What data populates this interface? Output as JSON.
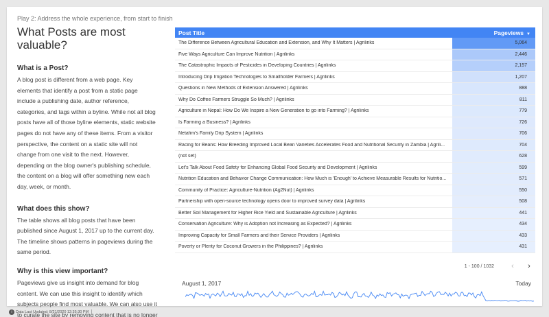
{
  "header": {
    "play_title": "Play 2: Address the whole experience, from start to finish",
    "main_title": "What Posts are most valuable?"
  },
  "sections": [
    {
      "heading": "What is a Post?",
      "body": "A blog post is different from a web page. Key elements that identify a post from a static page include a publishing date, author reference, categories, and tags within a byline. While not all blog posts have all of those byline elements, static website pages do not have any of these items. From a visitor perspective, the content on a static site will not change from one visit to the next. However, depending on the blog owner's publishing schedule, the content on a blog will offer something new each day, week, or month."
    },
    {
      "heading": "What does this show?",
      "body": "The table shows all blog posts that have been published since August 1, 2017 up to the current day. The timeline shows patterns in pageviews during the same period."
    },
    {
      "heading": "Why is this view important?",
      "body": "Pageviews give us insight into demand for blog content. We can use this insight to identify which subjects people find most valuable. We can also use it to curate the site by removing content that is no longer in demand."
    }
  ],
  "table": {
    "col_title": "Post Title",
    "col_value": "Pageviews",
    "accent": "#4285f4",
    "rows": [
      {
        "title": "The Difference Between Agricultural Education and Extension, and Why It Matters | Agrilinks",
        "pageviews": "5,064",
        "value": 5064
      },
      {
        "title": "Five Ways Agriculture Can Improve Nutrition | Agrilinks",
        "pageviews": "2,446",
        "value": 2446
      },
      {
        "title": "The Catastrophic Impacts of Pesticides in Developing Countries | Agrilinks",
        "pageviews": "2,157",
        "value": 2157
      },
      {
        "title": "Introducing Drip Irrigation Technologies to Smallholder Farmers | Agrilinks",
        "pageviews": "1,207",
        "value": 1207
      },
      {
        "title": "Questions in New Methods of Extension Answered | Agrilinks",
        "pageviews": "888",
        "value": 888
      },
      {
        "title": "Why Do Coffee Farmers Struggle So Much? | Agrilinks",
        "pageviews": "811",
        "value": 811
      },
      {
        "title": "Agriculture in Nepal: How Do We Inspire a New Generation to go into Farming? | Agrilinks",
        "pageviews": "779",
        "value": 779
      },
      {
        "title": "Is Farming a Business? | Agrilinks",
        "pageviews": "726",
        "value": 726
      },
      {
        "title": "Netafim's Family Drip System | Agrilinks",
        "pageviews": "706",
        "value": 706
      },
      {
        "title": "Racing for Beans: How Breeding Improved Local Bean Varieties Accelerates Food and Nutritional Security in Zambia | Agrili...",
        "pageviews": "704",
        "value": 704
      },
      {
        "title": "(not set)",
        "pageviews": "628",
        "value": 628
      },
      {
        "title": "Let's Talk About Food Safety for Enhancing Global Food Security and Development | Agrilinks",
        "pageviews": "599",
        "value": 599
      },
      {
        "title": "Nutrition Education and Behavior Change Communication: How Much is 'Enough' to Achieve Measurable Results for Nutritio...",
        "pageviews": "571",
        "value": 571
      },
      {
        "title": "Community of Practice: Agriculture-Nutrition (Ag2Nut) | Agrilinks",
        "pageviews": "550",
        "value": 550
      },
      {
        "title": "Partnership with open-source technology opens door to improved survey data | Agrilinks",
        "pageviews": "508",
        "value": 508
      },
      {
        "title": "Better Soil Management for Higher Rice Yield and Sustainable Agriculture | Agrilinks",
        "pageviews": "441",
        "value": 441
      },
      {
        "title": "Conservation Agriculture: Why is Adoption not Increasing as Expected? | Agrilinks",
        "pageviews": "434",
        "value": 434
      },
      {
        "title": "Improving Capacity for Small Farmers and their Service Providers | Agrilinks",
        "pageviews": "433",
        "value": 433
      },
      {
        "title": "Poverty or Plenty for Coconut Growers in the Philippines? | Agrilinks",
        "pageviews": "431",
        "value": 431
      }
    ]
  },
  "pager": {
    "range": "1 - 100 / 1032",
    "prev_icon": "chevron-left-icon",
    "next_icon": "chevron-right-icon"
  },
  "timeline": {
    "start_label": "August 1, 2017",
    "end_label": "Today",
    "line_color": "#4285f4"
  },
  "footer": {
    "text": "Data Last Updated: 8/21/2020 12:35:30 PM"
  }
}
